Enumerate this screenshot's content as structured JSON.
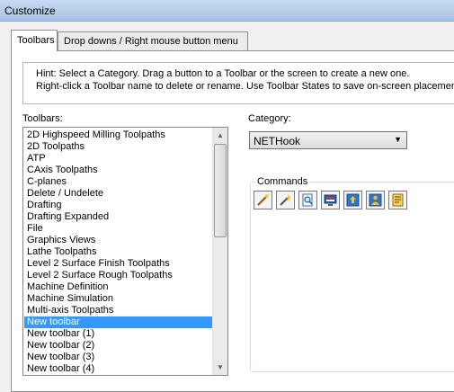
{
  "window": {
    "title": "Customize"
  },
  "tabs": [
    {
      "label": "Toolbars",
      "active": true
    },
    {
      "label": "Drop downs / Right mouse button menu",
      "active": false
    }
  ],
  "hint": {
    "line1": "Hint:  Select a Category.  Drag a button to a Toolbar or the screen to create a new one.",
    "line2": "Right-click a Toolbar name to delete or rename.  Use Toolbar States to save on-screen placement."
  },
  "toolbars": {
    "label": "Toolbars:",
    "items": [
      "2D Highspeed Milling Toolpaths",
      "2D Toolpaths",
      "ATP",
      "CAxis Toolpaths",
      "C-planes",
      "Delete / Undelete",
      "Drafting",
      "Drafting Expanded",
      "File",
      "Graphics Views",
      "Lathe Toolpaths",
      "Level 2 Surface Finish Toolpaths",
      "Level 2 Surface Rough Toolpaths",
      "Machine Definition",
      "Machine Simulation",
      "Multi-axis Toolpaths",
      "New toolbar",
      "New toolbar (1)",
      "New toolbar (2)",
      "New toolbar (3)",
      "New toolbar (4)"
    ],
    "selected_index": 16
  },
  "category": {
    "label": "Category:",
    "value": "NETHook"
  },
  "commands": {
    "label": "Commands",
    "icons": [
      "wand-icon",
      "magic-wand-icon",
      "page-search-icon",
      "monitor-icon",
      "upload-icon",
      "user-upload-icon",
      "note-icon"
    ]
  },
  "colors": {
    "selection": "#3399ff",
    "panel": "#ffffff",
    "dialog": "#f0f0f0"
  }
}
